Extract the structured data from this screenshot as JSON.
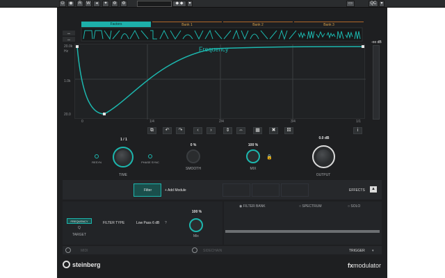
{
  "host": {
    "buttons": [
      "R",
      "W"
    ]
  },
  "tabs": [
    {
      "label": "Factors",
      "active": true
    },
    {
      "label": "Bank 1"
    },
    {
      "label": "Bank 2"
    },
    {
      "label": "Bank 3"
    }
  ],
  "graph": {
    "overlay_label": "Frequency",
    "y_ticks": [
      "20.0k",
      "Hz",
      "1.0k",
      "20.0"
    ],
    "x_ticks": [
      "0",
      "1/4",
      "2/4",
      "3/4",
      "1/1"
    ],
    "db_readout": "-oo dB"
  },
  "controls": {
    "time": {
      "value": "1 / 1",
      "label": "TIME",
      "left_btn": "RESYN",
      "right_btn": "PHASE SYNC"
    },
    "smooth": {
      "value": "0 %",
      "label": "SMOOTH"
    },
    "mix": {
      "value": "100 %",
      "label": "MIX"
    },
    "output": {
      "value": "0.0 dB",
      "label": "OUTPUT"
    }
  },
  "modules": {
    "filter_label": "Filter",
    "add_label": "+ Add Module",
    "effects_label": "EFFECTS"
  },
  "filter": {
    "target_btn": "FREQUENCY",
    "target_sub": "Q",
    "target_label": "TARGET",
    "type_label": "FILTER TYPE",
    "type_value": "Low Pass 6 dB",
    "help": "?",
    "mix_value": "100 %",
    "mix_label": "Mix",
    "radios": [
      "FILTER BANK",
      "SPECTRUM",
      "SOLO"
    ]
  },
  "footer_row": {
    "midi": "MIDI",
    "sidechain": "SIDECHAIN",
    "trigger": "TRIGGER"
  },
  "brand": {
    "logo": "steinberg",
    "product_bold": "fx",
    "product_rest": "modulator"
  },
  "colors": {
    "accent": "#1cb7ae",
    "tab_line": "#b2682a"
  }
}
